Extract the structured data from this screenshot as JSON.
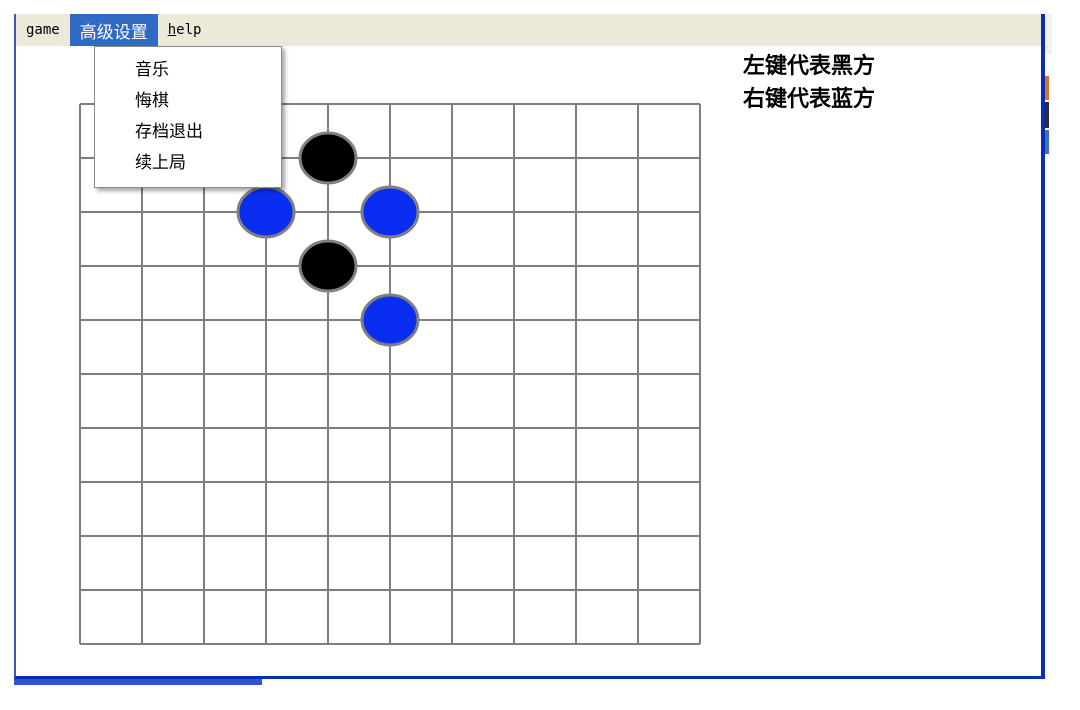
{
  "menubar": {
    "game": "game",
    "advanced": "高级设置",
    "help_first": "h",
    "help_rest": "elp"
  },
  "dropdown": {
    "items": [
      "音乐",
      "悔棋",
      "存档退出",
      "续上局"
    ]
  },
  "legend": {
    "left_key": "左键代表黑方",
    "right_key": "右键代表蓝方"
  },
  "board": {
    "columns": 10,
    "rows": 10,
    "line_color": "#7f7f7f",
    "black_color": "#000000",
    "blue_color": "#0a2ef0",
    "pieces": [
      {
        "color": "black",
        "col": 4,
        "row": 1
      },
      {
        "color": "blue",
        "col": 3,
        "row": 2
      },
      {
        "color": "blue",
        "col": 5,
        "row": 2
      },
      {
        "color": "black",
        "col": 4,
        "row": 3
      },
      {
        "color": "blue",
        "col": 5,
        "row": 4
      }
    ]
  },
  "colors": {
    "menu_bg": "#ece9d8",
    "menu_active": "#316ac5",
    "frame": "#0a2db8"
  }
}
